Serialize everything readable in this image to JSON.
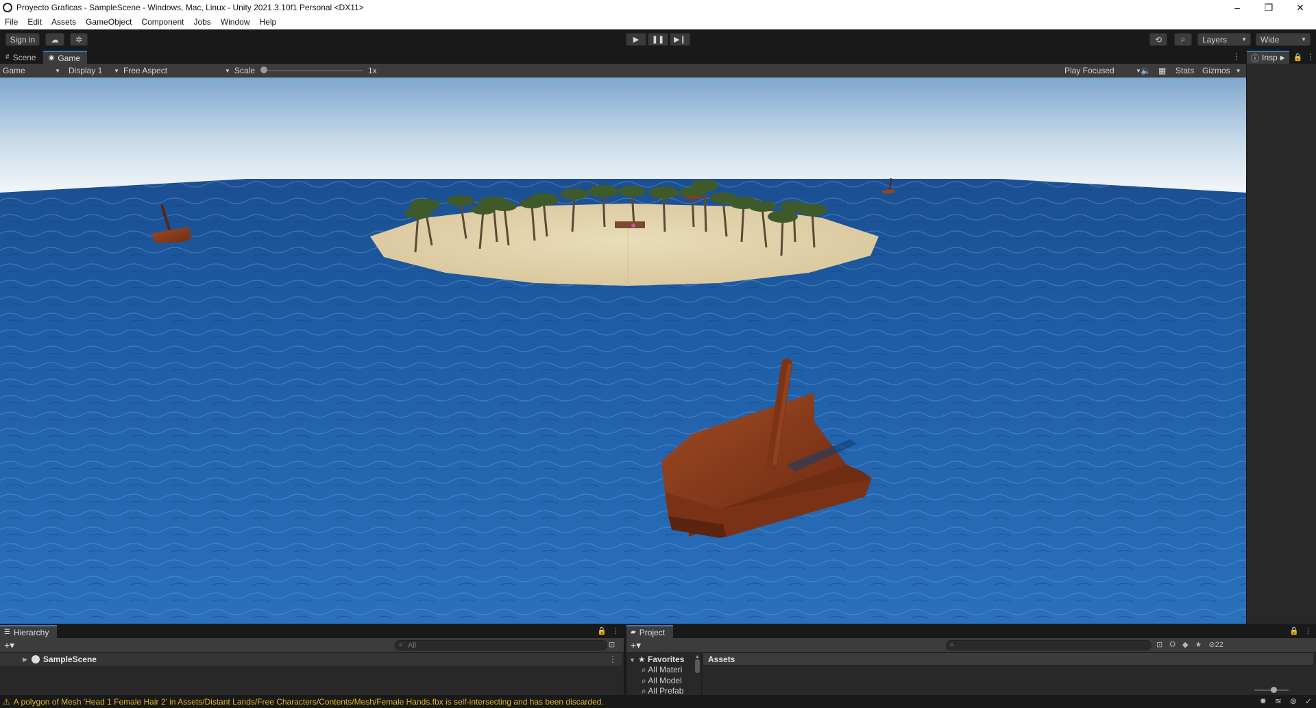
{
  "window": {
    "title": "Proyecto Graficas - SampleScene - Windows, Mac, Linux - Unity 2021.3.10f1 Personal <DX11>",
    "controls": [
      "–",
      "❐",
      "✕"
    ]
  },
  "menu": [
    "File",
    "Edit",
    "Assets",
    "GameObject",
    "Component",
    "Jobs",
    "Window",
    "Help"
  ],
  "toolbar": {
    "sign_in": "Sign in",
    "layers": "Layers",
    "layout": "Wide",
    "play_icons": [
      "▶",
      "❚❚",
      "▶❙"
    ]
  },
  "game_view": {
    "tabs": [
      "Scene",
      "Game"
    ],
    "mode": "Game",
    "display": "Display 1",
    "aspect": "Free Aspect",
    "scale_label": "Scale",
    "scale_value": "1x",
    "play_mode": "Play Focused",
    "stats": "Stats",
    "gizmos": "Gizmos"
  },
  "inspector": {
    "tab": "Insp"
  },
  "hierarchy": {
    "tab": "Hierarchy",
    "search_placeholder": "All",
    "scene": "SampleScene"
  },
  "project": {
    "tab": "Project",
    "favorites_label": "Favorites",
    "favorites": [
      "All Materi",
      "All Model",
      "All Prefab"
    ],
    "assets_label": "Assets",
    "hidden_count": "22"
  },
  "status": {
    "message": "A polygon of Mesh 'Head 1 Female Hair 2' in Assets/Distant Lands/Free Characters/Contents/Mesh/Female Hands.fbx is self-intersecting and has been discarded."
  },
  "colors": {
    "sky_top": "#7fa7cf",
    "sky_horizon": "#f4f7f9",
    "ocean": "#1f5fa8",
    "sand": "#e3d5b0",
    "boat_wood": "#8a3b1c",
    "accent": "#3a79bb",
    "warning": "#e8b41c"
  }
}
